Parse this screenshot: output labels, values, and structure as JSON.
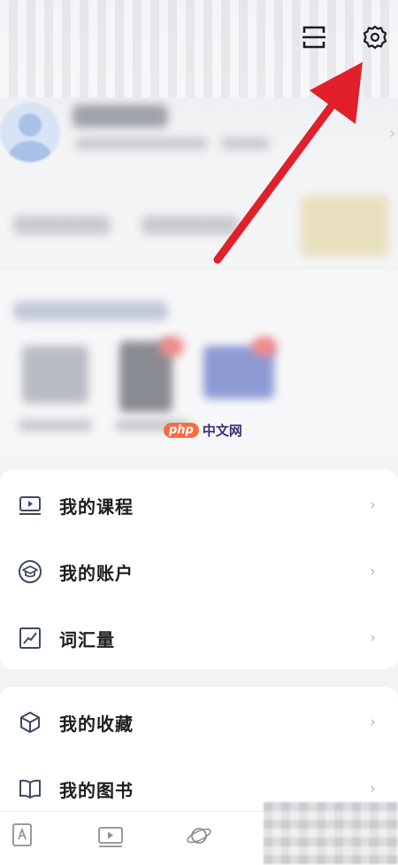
{
  "menu_group_1": [
    {
      "label": "我的课程",
      "icon": "video-course-icon"
    },
    {
      "label": "我的账户",
      "icon": "graduation-cap-icon"
    },
    {
      "label": "词汇量",
      "icon": "line-chart-icon"
    }
  ],
  "menu_group_2": [
    {
      "label": "我的收藏",
      "icon": "cube-icon"
    },
    {
      "label": "我的图书",
      "icon": "open-book-icon"
    }
  ],
  "watermark": {
    "badge": "php",
    "text": "中文网"
  },
  "tabs": [
    {
      "icon": "dictionary-icon"
    },
    {
      "icon": "video-play-icon"
    },
    {
      "icon": "planet-icon"
    }
  ],
  "colors": {
    "arrow": "#e0202a",
    "icon": "#3b4a63",
    "accent": "#ff6a3d"
  }
}
